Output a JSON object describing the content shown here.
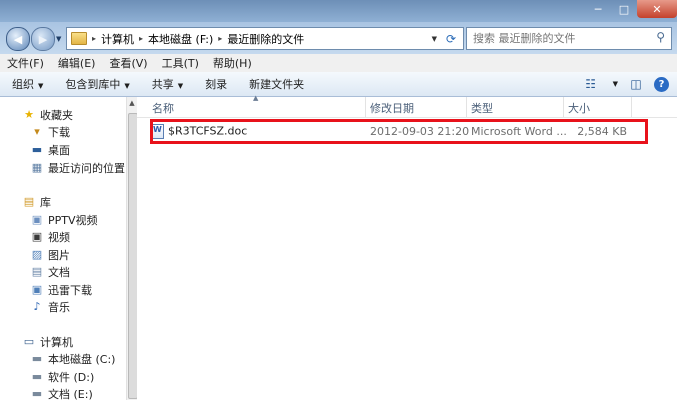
{
  "window": {
    "minimize": "─",
    "maximize": "□",
    "close": "✕"
  },
  "nav": {
    "back": "◀",
    "forward": "▶",
    "dropdown": "▼"
  },
  "address": {
    "segments": [
      "计算机",
      "本地磁盘 (F:)",
      "最近删除的文件"
    ],
    "dropdown": "▼",
    "refresh": "⟳"
  },
  "search": {
    "placeholder": "搜索 最近删除的文件"
  },
  "menu": [
    "文件(F)",
    "编辑(E)",
    "查看(V)",
    "工具(T)",
    "帮助(H)"
  ],
  "toolbar": {
    "organize": "组织",
    "include_library": "包含到库中",
    "share": "共享",
    "burn": "刻录",
    "new_folder": "新建文件夹",
    "help": "?"
  },
  "sidebar": {
    "favorites": {
      "label": "收藏夹",
      "items": [
        "下载",
        "桌面",
        "最近访问的位置"
      ]
    },
    "libraries": {
      "label": "库",
      "items": [
        "PPTV视频",
        "视频",
        "图片",
        "文档",
        "迅雷下载",
        "音乐"
      ]
    },
    "computer": {
      "label": "计算机",
      "items": [
        "本地磁盘 (C:)",
        "软件 (D:)",
        "文档 (E:)"
      ]
    }
  },
  "columns": [
    "名称",
    "修改日期",
    "类型",
    "大小"
  ],
  "files": [
    {
      "name": "$R3TCFSZ.doc",
      "modified": "2012-09-03 21:20",
      "type": "Microsoft Word ...",
      "size": "2,584 KB"
    }
  ],
  "colors": {
    "highlight": "#e8121b"
  }
}
